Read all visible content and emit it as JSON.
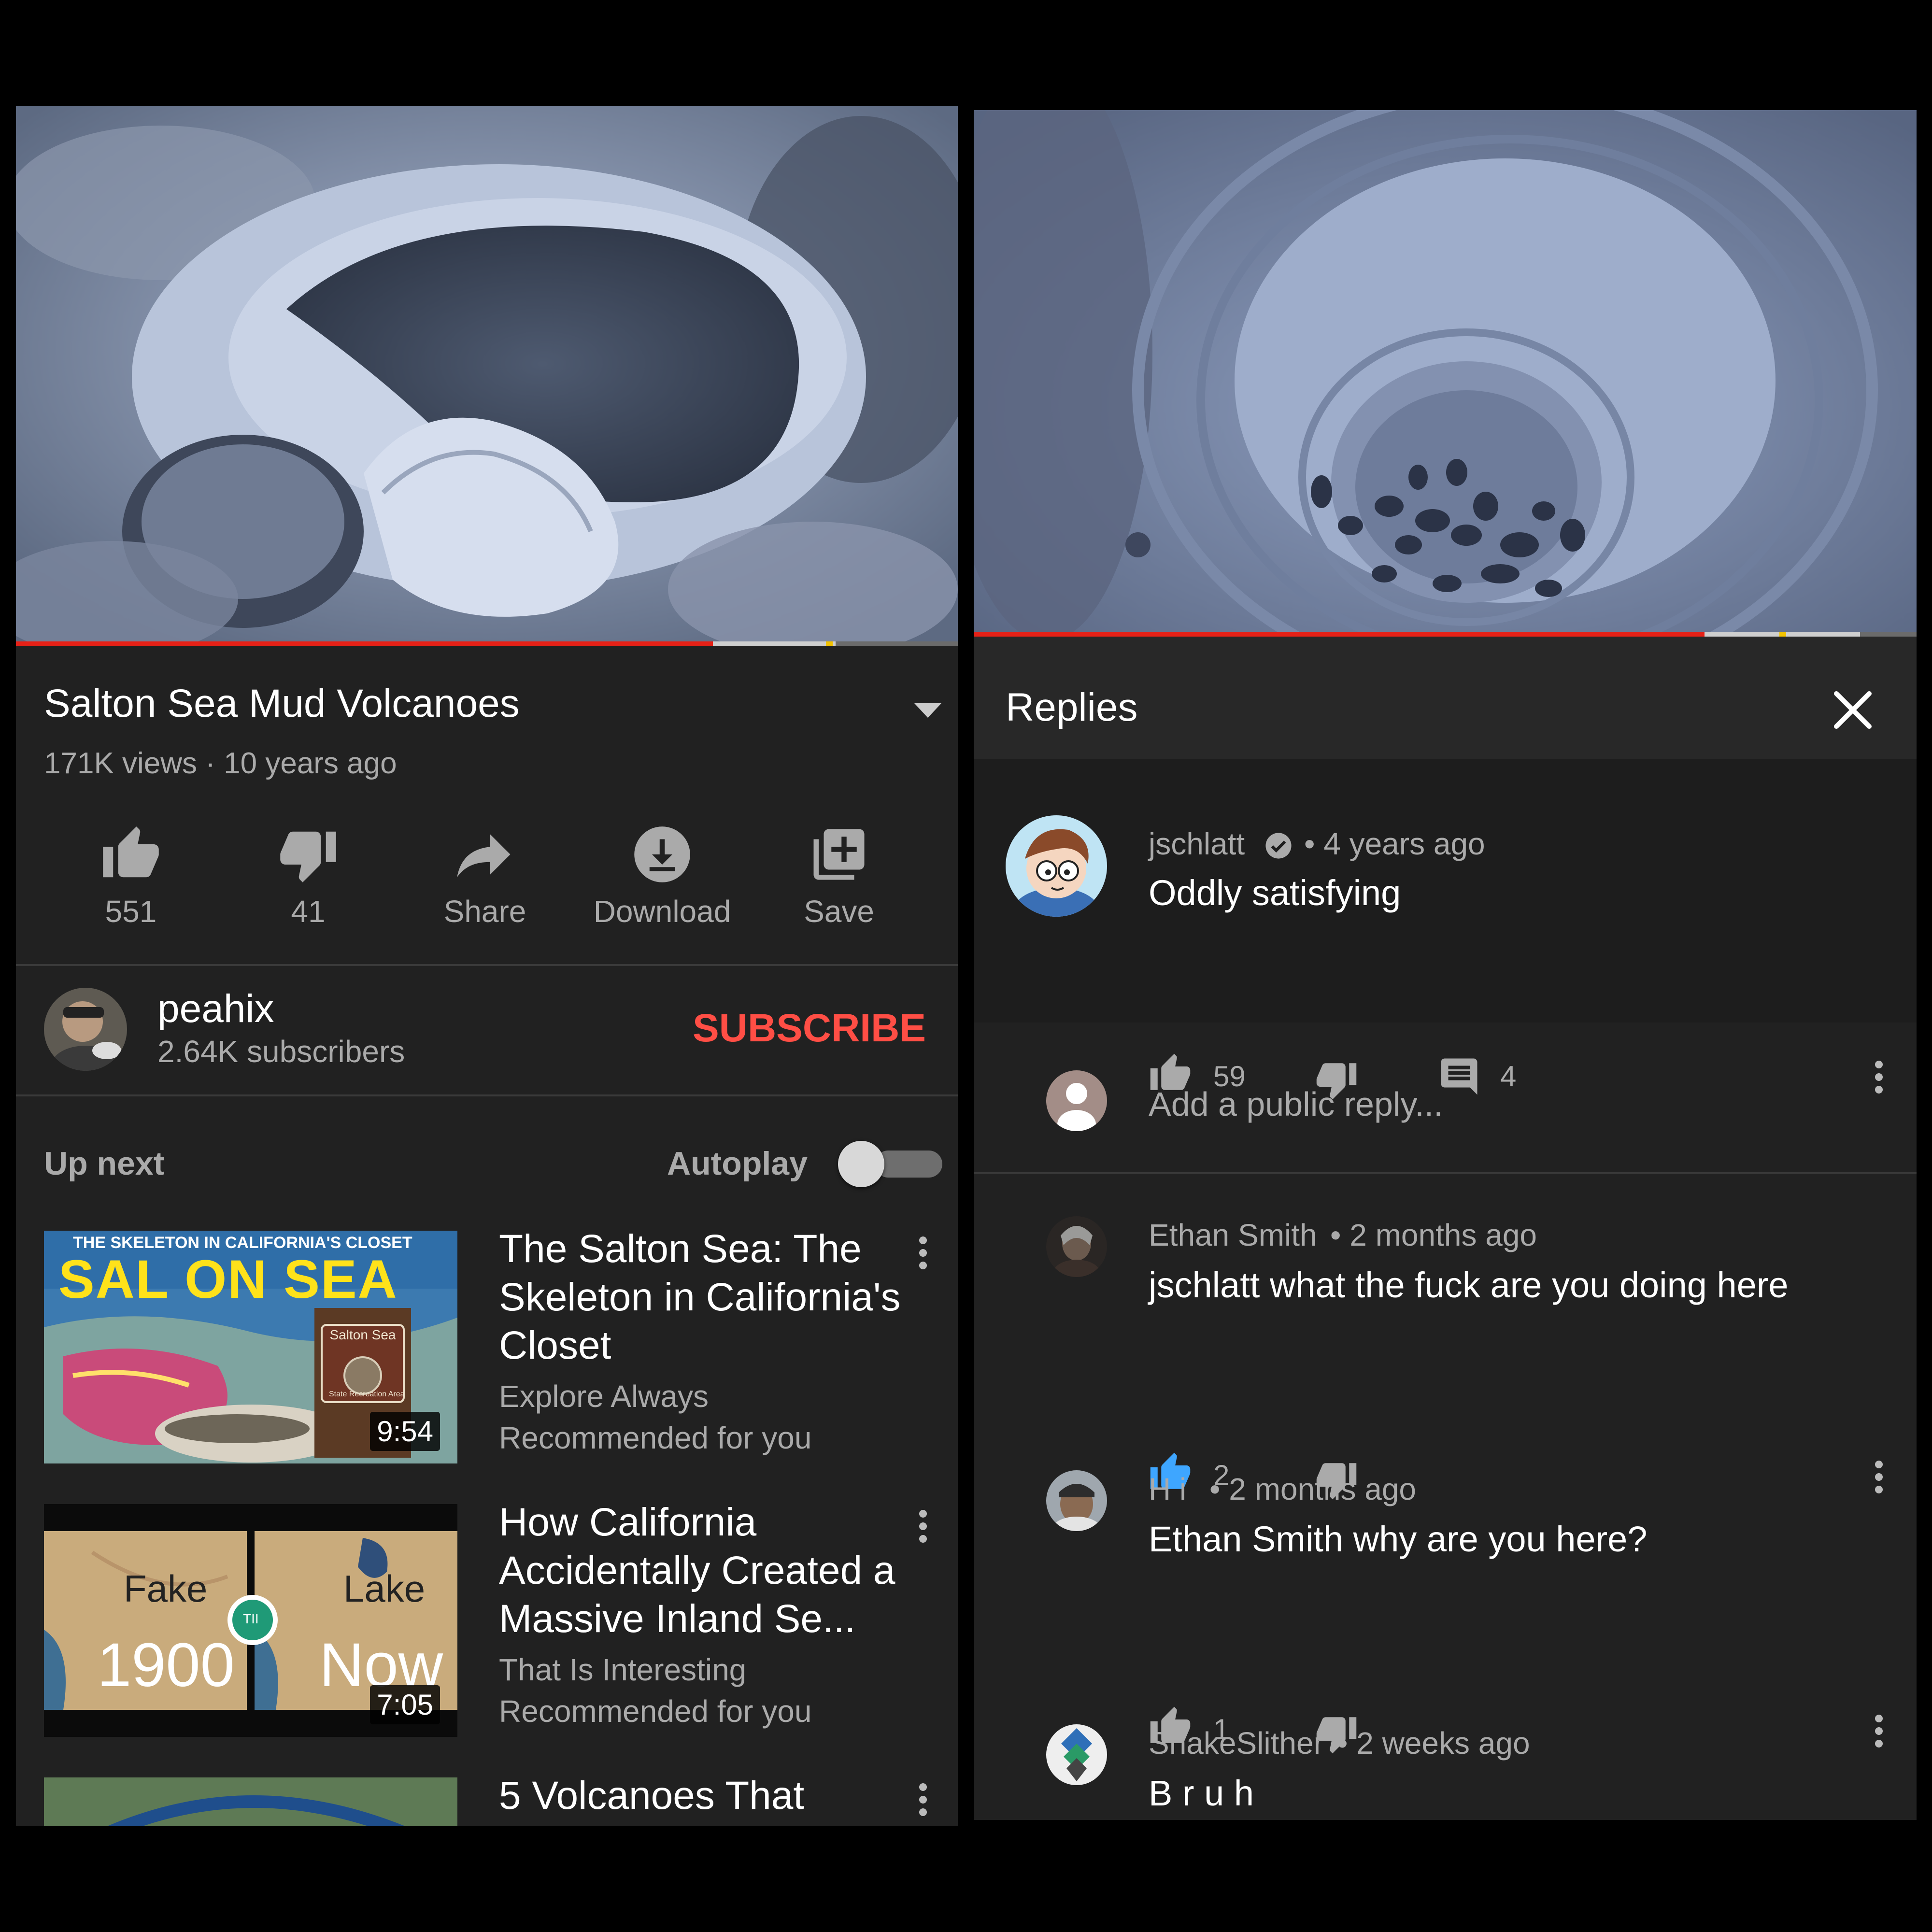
{
  "left": {
    "video": {
      "title": "Salton Sea Mud Volcanoes",
      "meta": "171K views · 10 years ago",
      "progress_played": 0.74,
      "progress_buffered": 0.87
    },
    "actions": {
      "like_count": "551",
      "dislike_count": "41",
      "share_label": "Share",
      "download_label": "Download",
      "save_label": "Save"
    },
    "channel": {
      "name": "peahix",
      "subscribers": "2.64K subscribers",
      "subscribe_label": "SUBSCRIBE"
    },
    "up_next": {
      "heading": "Up next",
      "autoplay_label": "Autoplay",
      "autoplay_on": false
    },
    "recommendations": [
      {
        "title": "The Salton Sea: The Skeleton in California's Closet",
        "channel": "Explore Always",
        "reason": "Recommended for you",
        "duration": "9:54",
        "thumb_top_text": "THE SKELETON IN CALIFORNIA'S CLOSET",
        "thumb_big_text": "SAL ON SEA",
        "thumb_sign_title": "Salton Sea",
        "thumb_sign_small": "State Recreation Area"
      },
      {
        "title": "How California Accidentally Created a Massive Inland Se...",
        "channel": "That Is Interesting",
        "reason": "Recommended for you",
        "duration": "7:05",
        "thumb_left_label": "Fake",
        "thumb_right_label": "Lake",
        "thumb_left_year": "1900",
        "thumb_right_year": "Now",
        "thumb_badge": "TII"
      },
      {
        "title": "5 Volcanoes That"
      }
    ]
  },
  "right": {
    "video": {
      "progress_played": 0.775,
      "progress_buffered": 0.94
    },
    "header": {
      "title": "Replies"
    },
    "top_comment": {
      "author": "jschlatt",
      "time": "• 4 years ago",
      "text": "Oddly satisfying",
      "likes": "59",
      "replies": "4"
    },
    "reply_box": {
      "placeholder": "Add a public reply..."
    },
    "replies": [
      {
        "author": "Ethan Smith",
        "time": "• 2 months ago",
        "text": "jschlatt what the fuck are you doing here",
        "likes": "2",
        "liked": true
      },
      {
        "author": "H i",
        "time": "• 2 months ago",
        "text": "Ethan Smith why are you here?",
        "likes": "1",
        "liked": false
      },
      {
        "author": "SnakeSlither",
        "time": "• 2 weeks ago",
        "text": "B r u h"
      }
    ]
  },
  "colors": {
    "panel_bg": "#212121",
    "subscribe_red": "#ff4e45",
    "progress_red": "#e62117",
    "liked_blue": "#3ea6ff",
    "muted_text": "#aaaaaa"
  },
  "icons": [
    "thumbs-up-icon",
    "thumbs-down-icon",
    "share-icon",
    "download-icon",
    "save-playlist-icon",
    "dropdown-arrow-icon",
    "close-icon",
    "reply-comment-icon",
    "more-vert-icon",
    "verified-check-icon"
  ]
}
